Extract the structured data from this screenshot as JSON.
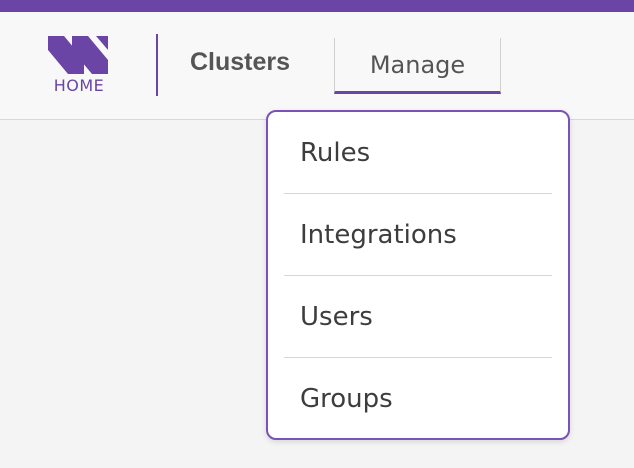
{
  "brand": {
    "logo_label": "HOME",
    "accent_color": "#6a45a6"
  },
  "nav": {
    "clusters_label": "Clusters",
    "manage_label": "Manage"
  },
  "manage_menu": {
    "items": [
      {
        "label": "Rules"
      },
      {
        "label": "Integrations"
      },
      {
        "label": "Users"
      },
      {
        "label": "Groups"
      }
    ]
  }
}
